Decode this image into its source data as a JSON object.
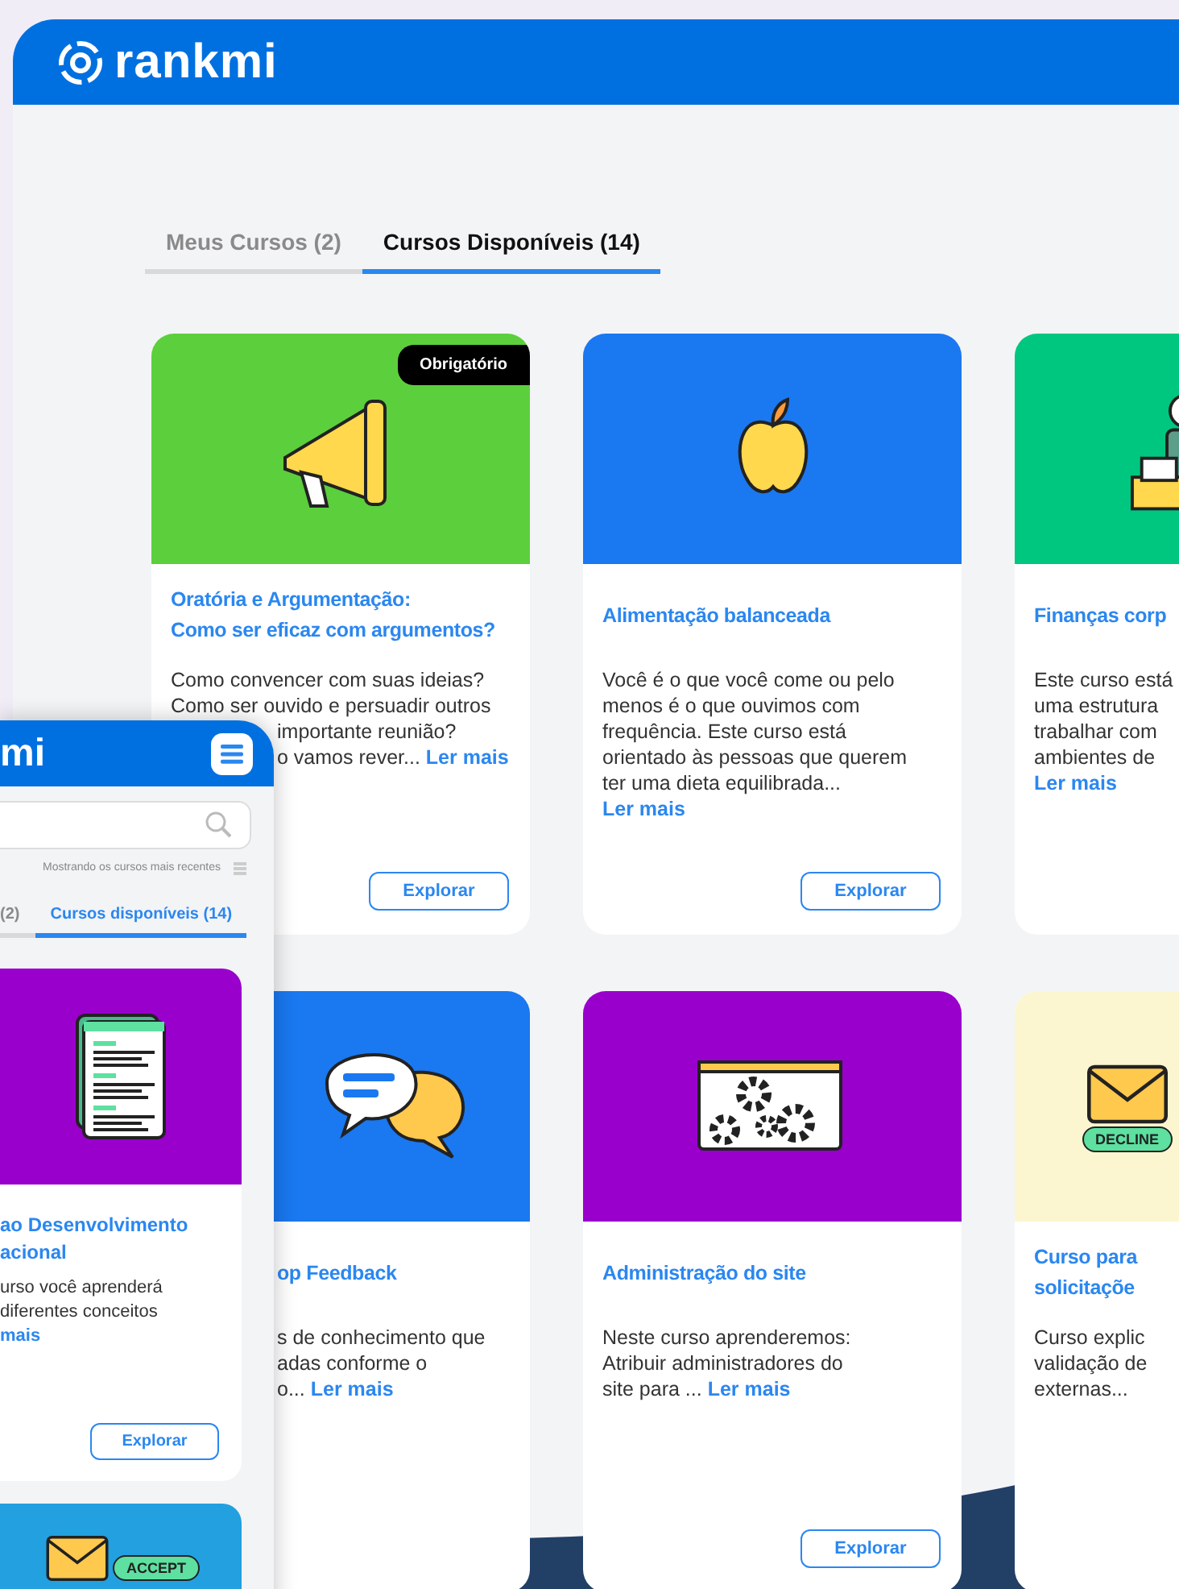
{
  "logo": "rankmi",
  "tabs": [
    {
      "label": "Meus Cursos (2)",
      "selected": false
    },
    {
      "label": "Cursos Disponíveis (14)",
      "selected": true
    }
  ],
  "courses": [
    {
      "kind": "megaphone",
      "color": "#5ccf3c",
      "badge": "Obrigatório",
      "title_lines": [
        "Oratória e Argumentação:",
        "Como ser eficaz com argumentos?"
      ],
      "desc_lines": [
        {
          "text": "Como convencer com suas ideias?"
        },
        {
          "text": "Como ser ouvido e persuadir outros"
        },
        {
          "text": "importante reunião?"
        },
        {
          "text": "o vamos rever...",
          "link": "Ler mais"
        }
      ],
      "button": "Explorar"
    },
    {
      "kind": "apple",
      "color": "#1a78f0",
      "title_lines": [
        "Alimentação balanceada"
      ],
      "desc_lines": [
        {
          "text": "Você é o que você come ou pelo"
        },
        {
          "text": "menos é o que ouvimos com"
        },
        {
          "text": "frequência. Este curso está"
        },
        {
          "text": "orientado às pessoas que querem"
        },
        {
          "text": "ter uma dieta equilibrada..."
        },
        {
          "link": "Ler mais"
        }
      ],
      "button": "Explorar"
    },
    {
      "kind": "money",
      "color": "#00c77f",
      "title_lines": [
        "Finanças corp"
      ],
      "desc_lines": [
        {
          "text": "Este curso está"
        },
        {
          "text": "uma estrutura"
        },
        {
          "text": "trabalhar com"
        },
        {
          "text": "ambientes de"
        },
        {
          "link": "Ler mais"
        }
      ]
    },
    {
      "kind": "chat",
      "color": "#1a78f0",
      "title_lines": [
        "op Feedback"
      ],
      "desc_lines": [
        {
          "text": "s de conhecimento que"
        },
        {
          "text": "adas conforme o"
        },
        {
          "text": "o...",
          "link": "Ler mais"
        }
      ]
    },
    {
      "kind": "gears",
      "color": "#9900cc",
      "title_lines": [
        "Administração do site"
      ],
      "desc_lines": [
        {
          "text": "Neste curso aprenderemos:"
        },
        {
          "text": "Atribuir administradores do"
        },
        {
          "text": "site para ...",
          "link": "Ler mais"
        }
      ],
      "button": "Explorar"
    },
    {
      "kind": "envelope",
      "color": "#fcf6d0",
      "image_label": "DECLINE",
      "title_lines": [
        "Curso para",
        "solicitaçõe"
      ],
      "desc_lines": [
        {
          "text": "Curso explic"
        },
        {
          "text": "validação de"
        },
        {
          "text": "externas..."
        }
      ]
    }
  ],
  "mobile": {
    "logo": "mi",
    "info": "Mostrando os cursos mais recentes",
    "tabs": [
      {
        "label": "(2)",
        "selected": false
      },
      {
        "label": "Cursos disponíveis (14)",
        "selected": true
      }
    ],
    "courses": [
      {
        "kind": "document",
        "color": "#9900cc",
        "title_lines": [
          "ao Desenvolvimento",
          "acional"
        ],
        "desc_lines": [
          "urso você aprenderá",
          "diferentes conceitos"
        ],
        "link": "mais",
        "button": "Explorar"
      },
      {
        "kind": "envelope",
        "color": "#22a0e0",
        "image_label": "ACCEPT"
      }
    ]
  }
}
